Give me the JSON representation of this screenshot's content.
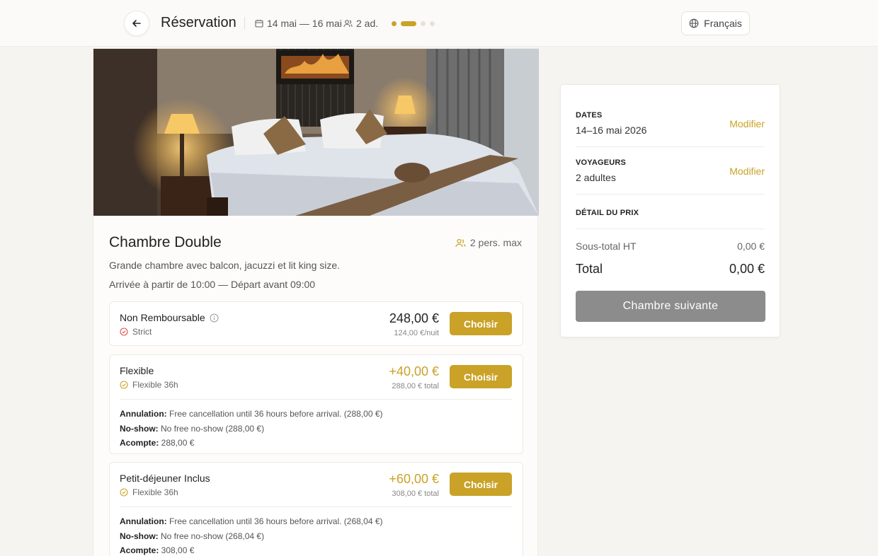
{
  "header": {
    "title": "Réservation",
    "dates": "14 mai — 16 mai",
    "guests": "2 ad.",
    "language": "Français"
  },
  "room": {
    "name": "Chambre Double",
    "capacity": "2 pers. max",
    "description": "Grande chambre avec balcon, jacuzzi et lit king size.",
    "times": "Arrivée à partir de 10:00 — Départ avant 09:00"
  },
  "rates": [
    {
      "name": "Non Remboursable",
      "policy": "Strict",
      "price": "248,00 €",
      "sub": "124,00 €/nuit",
      "button": "Choisir"
    },
    {
      "name": "Flexible",
      "policy": "Flexible 36h",
      "price": "+40,00 €",
      "sub": "288,00 € total",
      "button": "Choisir",
      "annulation_label": "Annulation:",
      "annulation": " Free cancellation until 36 hours before arrival. (288,00 €)",
      "noshow_label": "No-show:",
      "noshow": " No free no-show (288,00 €)",
      "acompte_label": "Acompte:",
      "acompte": " 288,00 €"
    },
    {
      "name": "Petit-déjeuner Inclus",
      "policy": "Flexible 36h",
      "price": "+60,00 €",
      "sub": "308,00 € total",
      "button": "Choisir",
      "annulation_label": "Annulation:",
      "annulation": " Free cancellation until 36 hours before arrival. (268,04 €)",
      "noshow_label": "No-show:",
      "noshow": " No free no-show (268,04 €)",
      "acompte_label": "Acompte:",
      "acompte": " 308,00 €"
    }
  ],
  "summary": {
    "dates_label": "DATES",
    "dates_value": "14–16 mai 2026",
    "voyageurs_label": "VOYAGEURS",
    "voyageurs_value": "2 adultes",
    "modify": "Modifier",
    "price_detail_label": "DÉTAIL DU PRIX",
    "subtotal_label": "Sous-total HT",
    "subtotal_value": "0,00 €",
    "total_label": "Total",
    "total_value": "0,00 €",
    "next_button": "Chambre suivante"
  },
  "colors": {
    "accent": "#c9a227",
    "disabled_button": "#8c8c8c",
    "strict_icon": "#d9534f"
  },
  "icons": [
    "arrow-left-icon",
    "calendar-icon",
    "users-icon",
    "globe-icon",
    "info-icon",
    "check-circle-icon"
  ]
}
